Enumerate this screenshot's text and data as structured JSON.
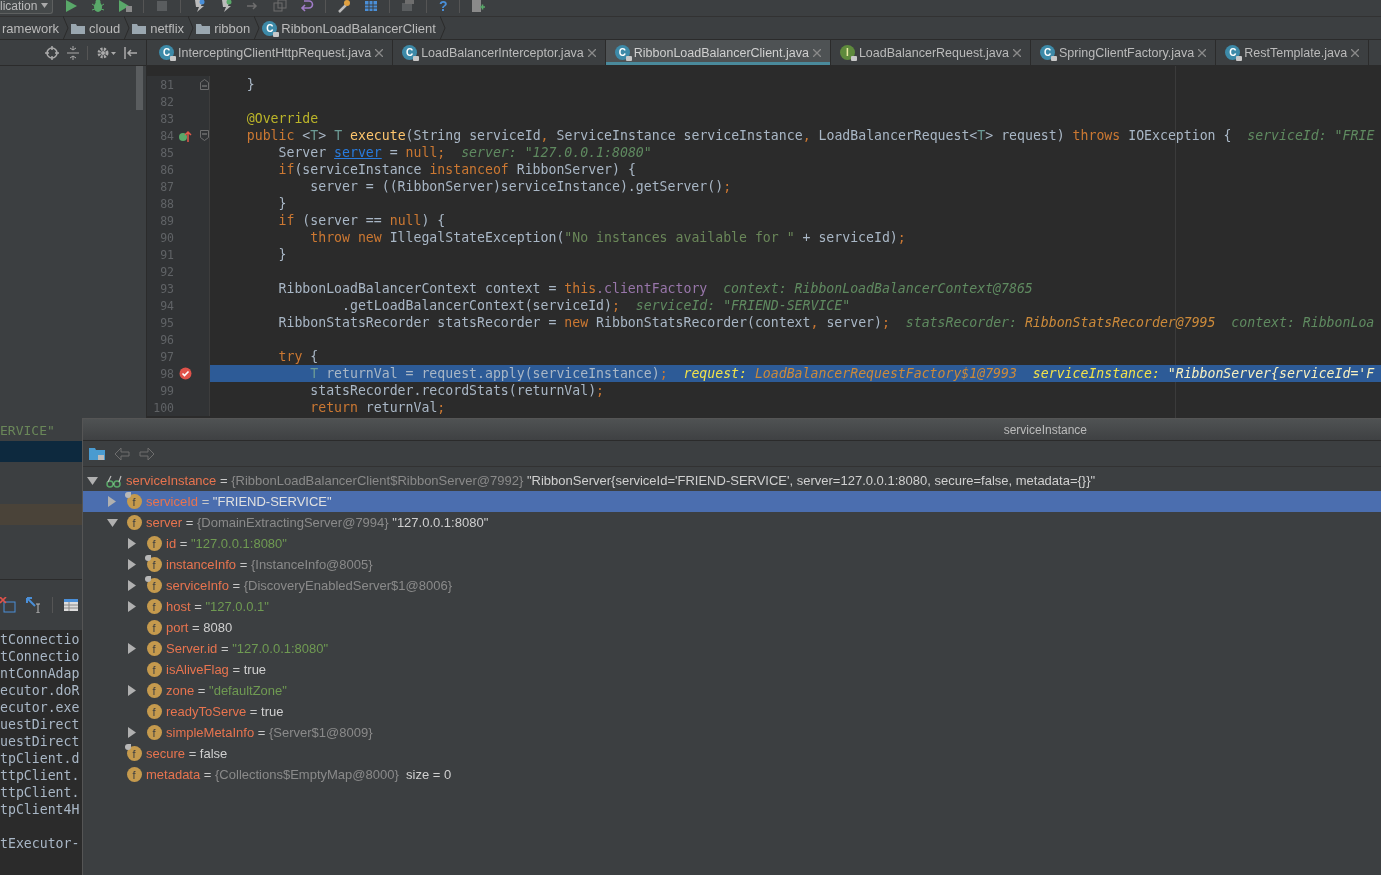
{
  "toolbar": {
    "run_config": "lication",
    "help": "?"
  },
  "breadcrumbs": [
    {
      "label": "ramework",
      "kind": "text"
    },
    {
      "label": "cloud",
      "kind": "folder"
    },
    {
      "label": "netflix",
      "kind": "folder"
    },
    {
      "label": "ribbon",
      "kind": "folder"
    },
    {
      "label": "RibbonLoadBalancerClient",
      "kind": "class",
      "badge": "C"
    }
  ],
  "tabs": [
    {
      "label": "InterceptingClientHttpRequest.java",
      "kind": "class",
      "badge": "C",
      "selected": false
    },
    {
      "label": "LoadBalancerInterceptor.java",
      "kind": "class",
      "badge": "C",
      "selected": false
    },
    {
      "label": "RibbonLoadBalancerClient.java",
      "kind": "class",
      "badge": "C",
      "selected": true
    },
    {
      "label": "LoadBalancerRequest.java",
      "kind": "interface",
      "badge": "I",
      "selected": false
    },
    {
      "label": "SpringClientFactory.java",
      "kind": "class",
      "badge": "C",
      "selected": false
    },
    {
      "label": "RestTemplate.java",
      "kind": "class",
      "badge": "C",
      "selected": false
    }
  ],
  "variables_pane": {
    "rows": [
      {
        "text": "ERVICE\"",
        "selected": false,
        "highlighted": false
      },
      {
        "selected": true,
        "highlighted": false
      },
      {
        "selected": false,
        "highlighted": false
      },
      {
        "selected": false,
        "highlighted": false
      },
      {
        "selected": false,
        "highlighted": true
      }
    ]
  },
  "frames": [
    "tConnectio",
    "tConnectio",
    "ntConnAdap",
    "ecutor.doR",
    "ecutor.exe",
    "uestDirect",
    "uestDirect",
    "tpClient.d",
    "ttpClient.",
    "ttpClient.",
    "tpClient4H"
  ],
  "frames_after_gap": [
    "tExecutor-"
  ],
  "editor": {
    "lines": [
      {
        "number": "81",
        "fold": {
          "kind": "end"
        },
        "tokens": [
          {
            "kind": "plain",
            "text": "    }"
          }
        ]
      },
      {
        "number": "82"
      },
      {
        "number": "83",
        "tokens": [
          {
            "kind": "ann",
            "text": "    @Override"
          }
        ]
      },
      {
        "number": "84",
        "fold": {
          "kind": "start"
        },
        "marker": {
          "kind": "override"
        },
        "tokens": [
          {
            "kind": "kw",
            "text": "    public "
          },
          {
            "kind": "plain",
            "text": "<"
          },
          {
            "kind": "tparam",
            "text": "T"
          },
          {
            "kind": "plain",
            "text": "> "
          },
          {
            "kind": "tparam",
            "text": "T "
          },
          {
            "kind": "decl",
            "text": "execute"
          },
          {
            "kind": "plain",
            "text": "(String serviceId"
          },
          {
            "kind": "kw",
            "text": ", "
          },
          {
            "kind": "plain",
            "text": "ServiceInstance serviceInstance"
          },
          {
            "kind": "kw",
            "text": ", "
          },
          {
            "kind": "plain",
            "text": "LoadBalancerRequest<"
          },
          {
            "kind": "tparam",
            "text": "T"
          },
          {
            "kind": "plain",
            "text": "> request) "
          },
          {
            "kind": "kw",
            "text": "throws "
          },
          {
            "kind": "plain",
            "text": "IOException {"
          },
          {
            "kind": "hint",
            "text": "  serviceId: \"FRIE"
          }
        ]
      },
      {
        "number": "85",
        "tokens": [
          {
            "kind": "plain",
            "text": "        Server "
          },
          {
            "kind": "link",
            "text": "server"
          },
          {
            "kind": "plain",
            "text": " = "
          },
          {
            "kind": "kw",
            "text": "null;"
          },
          {
            "kind": "hint",
            "text": "  server: \"127.0.0.1:8080\""
          }
        ]
      },
      {
        "number": "86",
        "tokens": [
          {
            "kind": "kw",
            "text": "        if"
          },
          {
            "kind": "plain",
            "text": "(serviceInstance "
          },
          {
            "kind": "kw",
            "text": "instanceof"
          },
          {
            "kind": "plain",
            "text": " RibbonServer) {"
          }
        ]
      },
      {
        "number": "87",
        "tokens": [
          {
            "kind": "plain",
            "text": "            server = ((RibbonServer)serviceInstance).getServer()"
          },
          {
            "kind": "kw",
            "text": ";"
          }
        ]
      },
      {
        "number": "88",
        "tokens": [
          {
            "kind": "plain",
            "text": "        }"
          }
        ]
      },
      {
        "number": "89",
        "tokens": [
          {
            "kind": "kw",
            "text": "        if"
          },
          {
            "kind": "plain",
            "text": " (server == "
          },
          {
            "kind": "kw",
            "text": "null"
          },
          {
            "kind": "plain",
            "text": ") {"
          }
        ]
      },
      {
        "number": "90",
        "tokens": [
          {
            "kind": "kw",
            "text": "            throw new "
          },
          {
            "kind": "plain",
            "text": "IllegalStateException("
          },
          {
            "kind": "str",
            "text": "\"No instances available for \""
          },
          {
            "kind": "plain",
            "text": " + serviceId)"
          },
          {
            "kind": "kw",
            "text": ";"
          }
        ]
      },
      {
        "number": "91",
        "tokens": [
          {
            "kind": "plain",
            "text": "        }"
          }
        ]
      },
      {
        "number": "92"
      },
      {
        "number": "93",
        "tokens": [
          {
            "kind": "plain",
            "text": "        RibbonLoadBalancerContext context = "
          },
          {
            "kind": "kw",
            "text": "this"
          },
          {
            "kind": "field",
            "text": ".clientFactory"
          },
          {
            "kind": "hint",
            "text": "  context: RibbonLoadBalancerContext@7865"
          }
        ]
      },
      {
        "number": "94",
        "tokens": [
          {
            "kind": "plain",
            "text": "                .getLoadBalancerContext(serviceId)"
          },
          {
            "kind": "kw",
            "text": ";"
          },
          {
            "kind": "hint",
            "text": "  serviceId: \"FRIEND-SERVICE\""
          }
        ]
      },
      {
        "number": "95",
        "tokens": [
          {
            "kind": "plain",
            "text": "        RibbonStatsRecorder statsRecorder = "
          },
          {
            "kind": "kw",
            "text": "new "
          },
          {
            "kind": "plain",
            "text": "RibbonStatsRecorder(context"
          },
          {
            "kind": "kw",
            "text": ","
          },
          {
            "kind": "plain",
            "text": " server)"
          },
          {
            "kind": "kw",
            "text": ";"
          },
          {
            "kind": "hint",
            "text": "  statsRecorder: "
          },
          {
            "kind": "hintref",
            "text": "RibbonStatsRecorder@7995"
          },
          {
            "kind": "hint",
            "text": "  context: RibbonLoa"
          }
        ]
      },
      {
        "number": "96"
      },
      {
        "number": "97",
        "tokens": [
          {
            "kind": "kw",
            "text": "        try"
          },
          {
            "kind": "plain",
            "text": " {"
          }
        ]
      },
      {
        "number": "98",
        "marker": {
          "kind": "breakpoint"
        },
        "current": true,
        "tokens": [
          {
            "kind": "tparam",
            "text": "            T "
          },
          {
            "kind": "plain",
            "text": "returnVal = request.apply(serviceInstance)"
          },
          {
            "kind": "kw",
            "text": ";"
          },
          {
            "kind": "hintcur",
            "text": "  request: "
          },
          {
            "kind": "hintref",
            "text": "LoadBalancerRequestFactory$1@7993"
          },
          {
            "kind": "hintcur",
            "text": "  serviceInstance: "
          },
          {
            "kind": "hintcurval",
            "text": "\"RibbonServer{serviceId='F"
          }
        ]
      },
      {
        "number": "99",
        "tokens": [
          {
            "kind": "plain",
            "text": "            statsRecorder.recordStats(returnVal)"
          },
          {
            "kind": "kw",
            "text": ";"
          }
        ]
      },
      {
        "number": "100",
        "tokens": [
          {
            "kind": "kw",
            "text": "            return "
          },
          {
            "kind": "plain",
            "text": "returnVal"
          },
          {
            "kind": "kw",
            "text": ";"
          }
        ]
      }
    ]
  },
  "popup": {
    "title": "serviceInstance",
    "tree": [
      {
        "kind": "watch",
        "expanded": true,
        "selected": false,
        "segments": [
          {
            "kind": "name",
            "text": "serviceInstance"
          },
          {
            "kind": "op",
            "text": " = "
          },
          {
            "kind": "ref",
            "text": "{RibbonLoadBalancerClient$RibbonServer@7992} "
          },
          {
            "kind": "val",
            "text": "\"RibbonServer{serviceId='FRIEND-SERVICE', server=127.0.0.1:8080, secure=false, metadata={}}\""
          }
        ],
        "children": [
          {
            "kind": "field",
            "badge": "f",
            "marked": true,
            "expanded": false,
            "selected": true,
            "segments": [
              {
                "kind": "name",
                "text": "serviceId"
              },
              {
                "kind": "op",
                "text": " = "
              },
              {
                "kind": "sval",
                "text": "\"FRIEND-SERVICE\""
              }
            ]
          },
          {
            "kind": "field",
            "badge": "f",
            "expanded": true,
            "selected": false,
            "segments": [
              {
                "kind": "name",
                "text": "server"
              },
              {
                "kind": "op",
                "text": " = "
              },
              {
                "kind": "ref",
                "text": "{DomainExtractingServer@7994} "
              },
              {
                "kind": "val",
                "text": "\"127.0.0.1:8080\""
              }
            ],
            "children": [
              {
                "kind": "field",
                "badge": "f",
                "expanded": false,
                "selected": false,
                "segments": [
                  {
                    "kind": "name",
                    "text": "id"
                  },
                  {
                    "kind": "op",
                    "text": " = "
                  },
                  {
                    "kind": "str",
                    "text": "\"127.0.0.1:8080\""
                  }
                ]
              },
              {
                "kind": "field",
                "badge": "f",
                "marked": true,
                "expanded": false,
                "selected": false,
                "segments": [
                  {
                    "kind": "name",
                    "text": "instanceInfo"
                  },
                  {
                    "kind": "op",
                    "text": " = "
                  },
                  {
                    "kind": "ref",
                    "text": "{InstanceInfo@8005}"
                  }
                ]
              },
              {
                "kind": "field",
                "badge": "f",
                "marked": true,
                "expanded": false,
                "selected": false,
                "segments": [
                  {
                    "kind": "name",
                    "text": "serviceInfo"
                  },
                  {
                    "kind": "op",
                    "text": " = "
                  },
                  {
                    "kind": "ref",
                    "text": "{DiscoveryEnabledServer$1@8006}"
                  }
                ]
              },
              {
                "kind": "field",
                "badge": "f",
                "expanded": false,
                "selected": false,
                "segments": [
                  {
                    "kind": "name",
                    "text": "host"
                  },
                  {
                    "kind": "op",
                    "text": " = "
                  },
                  {
                    "kind": "str",
                    "text": "\"127.0.0.1\""
                  }
                ]
              },
              {
                "kind": "field",
                "badge": "f",
                "selected": false,
                "segments": [
                  {
                    "kind": "name",
                    "text": "port"
                  },
                  {
                    "kind": "op",
                    "text": " = "
                  },
                  {
                    "kind": "val",
                    "text": "8080"
                  }
                ]
              },
              {
                "kind": "field",
                "badge": "f",
                "expanded": false,
                "selected": false,
                "segments": [
                  {
                    "kind": "name",
                    "text": "Server.id"
                  },
                  {
                    "kind": "op",
                    "text": " = "
                  },
                  {
                    "kind": "str",
                    "text": "\"127.0.0.1:8080\""
                  }
                ]
              },
              {
                "kind": "field",
                "badge": "f",
                "selected": false,
                "segments": [
                  {
                    "kind": "name",
                    "text": "isAliveFlag"
                  },
                  {
                    "kind": "op",
                    "text": " = "
                  },
                  {
                    "kind": "val",
                    "text": "true"
                  }
                ]
              },
              {
                "kind": "field",
                "badge": "f",
                "expanded": false,
                "selected": false,
                "segments": [
                  {
                    "kind": "name",
                    "text": "zone"
                  },
                  {
                    "kind": "op",
                    "text": " = "
                  },
                  {
                    "kind": "str",
                    "text": "\"defaultZone\""
                  }
                ]
              },
              {
                "kind": "field",
                "badge": "f",
                "selected": false,
                "segments": [
                  {
                    "kind": "name",
                    "text": "readyToServe"
                  },
                  {
                    "kind": "op",
                    "text": " = "
                  },
                  {
                    "kind": "val",
                    "text": "true"
                  }
                ]
              },
              {
                "kind": "field",
                "badge": "f",
                "expanded": false,
                "selected": false,
                "segments": [
                  {
                    "kind": "name",
                    "text": "simpleMetaInfo"
                  },
                  {
                    "kind": "op",
                    "text": " = "
                  },
                  {
                    "kind": "ref",
                    "text": "{Server$1@8009}"
                  }
                ]
              }
            ]
          },
          {
            "kind": "field",
            "badge": "f",
            "marked": true,
            "selected": false,
            "segments": [
              {
                "kind": "name",
                "text": "secure"
              },
              {
                "kind": "op",
                "text": " = "
              },
              {
                "kind": "val",
                "text": "false"
              }
            ]
          },
          {
            "kind": "field",
            "badge": "f",
            "selected": false,
            "segments": [
              {
                "kind": "name",
                "text": "metadata"
              },
              {
                "kind": "op",
                "text": " = "
              },
              {
                "kind": "ref",
                "text": "{Collections$EmptyMap@8000}  "
              },
              {
                "kind": "val",
                "text": "size = 0"
              }
            ]
          }
        ]
      }
    ]
  }
}
